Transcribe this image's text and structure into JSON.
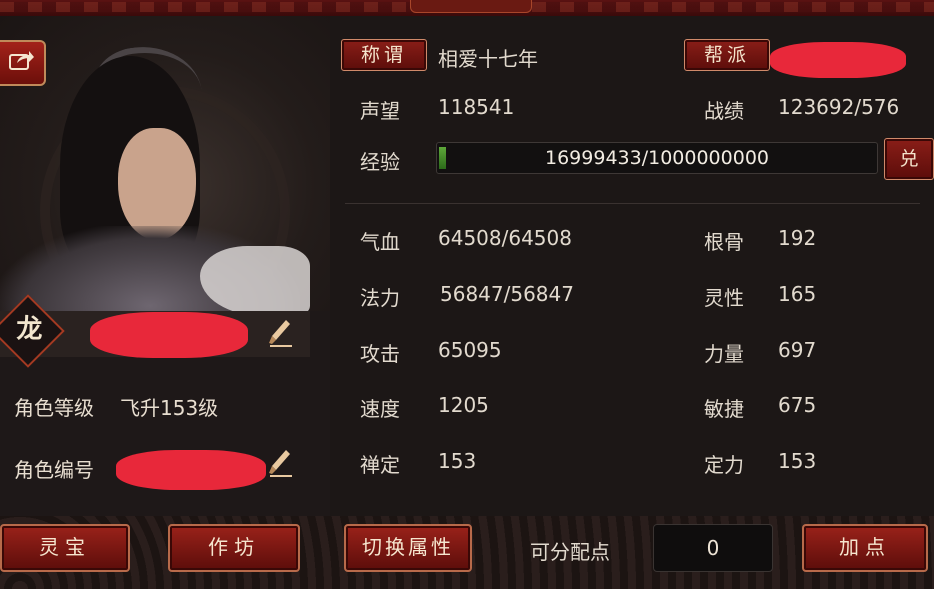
{
  "header": {
    "title": ""
  },
  "character": {
    "title_button": "称谓",
    "title_value": "相爱十七年",
    "guild_button": "帮派",
    "level_label": "角色等级",
    "level_value": "飞升153级",
    "id_label": "角色编号",
    "dragon_badge": "龙"
  },
  "stats_top": {
    "reputation_label": "声望",
    "reputation_value": "118541",
    "record_label": "战绩",
    "record_value": "123692/576",
    "exp_label": "经验",
    "exp_value": "16999433/1000000000",
    "exp_progress": 0.017,
    "exchange_button": "兑"
  },
  "stats": [
    {
      "label": "气血",
      "value": "64508/64508",
      "label2": "根骨",
      "value2": "192"
    },
    {
      "label": "法力",
      "value": "56847/56847",
      "label2": "灵性",
      "value2": "165"
    },
    {
      "label": "攻击",
      "value": "65095",
      "label2": "力量",
      "value2": "697"
    },
    {
      "label": "速度",
      "value": "1205",
      "label2": "敏捷",
      "value2": "675"
    },
    {
      "label": "禅定",
      "value": "153",
      "label2": "定力",
      "value2": "153"
    }
  ],
  "bottom": {
    "lingbao_button": "灵宝",
    "workshop_button": "作坊",
    "switch_attr_button": "切换属性",
    "points_label": "可分配点",
    "points_value": "0",
    "add_points_button": "加点"
  },
  "icons": {
    "share": "share-icon",
    "brush": "brush-icon"
  },
  "colors": {
    "button_red": "#8a1e18",
    "redaction": "#e8283a",
    "exp_fill": "#5ea83a"
  }
}
